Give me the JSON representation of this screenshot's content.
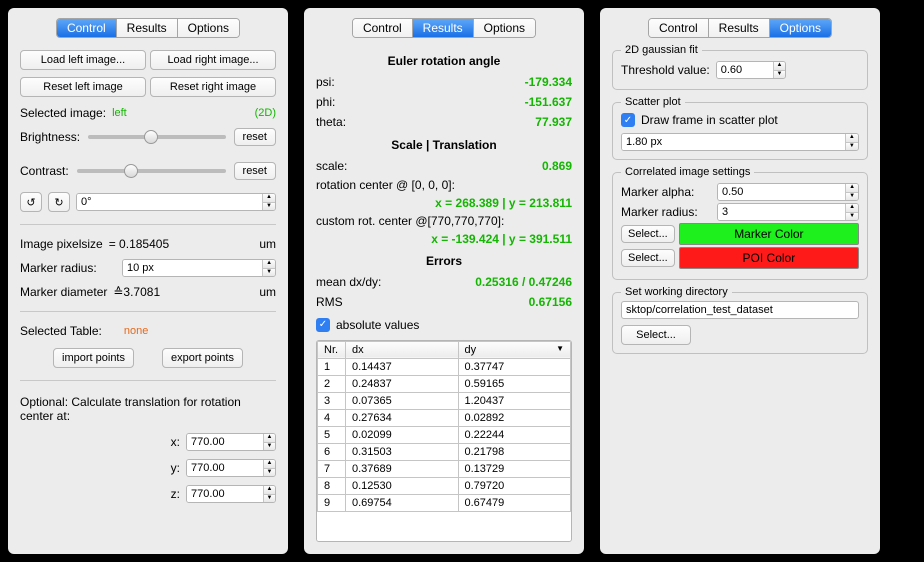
{
  "tabs": {
    "control": "Control",
    "results": "Results",
    "options": "Options"
  },
  "control": {
    "load_left": "Load left image...",
    "load_right": "Load right image...",
    "reset_left": "Reset left image",
    "reset_right": "Reset right image",
    "selected_image_label": "Selected image:",
    "selected_image_value": "left",
    "mode": "(2D)",
    "brightness_label": "Brightness:",
    "contrast_label": "Contrast:",
    "reset": "reset",
    "rotate_ccw": "↺",
    "rotate_cw": "↻",
    "angle": "0°",
    "pixelsize_label": "Image pixelsize",
    "pixelsize_value": "= 0.185405",
    "pixelsize_unit": "um",
    "marker_radius_label": "Marker radius:",
    "marker_radius_value": "10 px",
    "marker_diameter_label": "Marker diameter",
    "marker_diameter_delta": "≙3.7081",
    "marker_diameter_unit": "um",
    "selected_table_label": "Selected Table:",
    "selected_table_value": "none",
    "import_points": "import points",
    "export_points": "export points",
    "optional_text": "Optional: Calculate translation for rotation center at:",
    "x_label": "x:",
    "x_value": "770.00",
    "y_label": "y:",
    "y_value": "770.00",
    "z_label": "z:",
    "z_value": "770.00"
  },
  "results": {
    "euler_title": "Euler rotation angle",
    "psi_label": "psi:",
    "psi_value": "-179.334",
    "phi_label": "phi:",
    "phi_value": "-151.637",
    "theta_label": "theta:",
    "theta_value": "77.937",
    "scale_title": "Scale | Translation",
    "scale_label": "scale:",
    "scale_value": "0.869",
    "rot_center_label": "rotation center @ [0, 0, 0]:",
    "rot_center_value": "x = 268.389 | y = 213.811",
    "custom_rot_label": "custom rot. center @[770,770,770]:",
    "custom_rot_value": "x = -139.424 | y = 391.511",
    "errors_title": "Errors",
    "mean_label": "mean dx/dy:",
    "mean_value": "0.25316 / 0.47246",
    "rms_label": "RMS",
    "rms_value": "0.67156",
    "abs_label": "absolute values",
    "th_nr": "Nr.",
    "th_dx": "dx",
    "th_dy": "dy",
    "rows": [
      {
        "nr": "1",
        "dx": "0.14437",
        "dy": "0.37747"
      },
      {
        "nr": "2",
        "dx": "0.24837",
        "dy": "0.59165"
      },
      {
        "nr": "3",
        "dx": "0.07365",
        "dy": "1.20437"
      },
      {
        "nr": "4",
        "dx": "0.27634",
        "dy": "0.02892"
      },
      {
        "nr": "5",
        "dx": "0.02099",
        "dy": "0.22244"
      },
      {
        "nr": "6",
        "dx": "0.31503",
        "dy": "0.21798"
      },
      {
        "nr": "7",
        "dx": "0.37689",
        "dy": "0.13729"
      },
      {
        "nr": "8",
        "dx": "0.12530",
        "dy": "0.79720"
      },
      {
        "nr": "9",
        "dx": "0.69754",
        "dy": "0.67479"
      }
    ]
  },
  "options": {
    "gaussian_title": "2D gaussian fit",
    "threshold_label": "Threshold value:",
    "threshold_value": "0.60",
    "scatter_title": "Scatter plot",
    "draw_frame_label": "Draw frame in scatter plot",
    "frame_px": "1.80 px",
    "corr_title": "Correlated image settings",
    "marker_alpha_label": "Marker alpha:",
    "marker_alpha_value": "0.50",
    "marker_radius_label": "Marker radius:",
    "marker_radius_value": "3",
    "select": "Select...",
    "marker_color_label": "Marker Color",
    "poi_color_label": "POI Color",
    "marker_color": "#1ef01e",
    "poi_color": "#ff1a1a",
    "wd_title": "Set working directory",
    "wd_value": "sktop/correlation_test_dataset"
  }
}
